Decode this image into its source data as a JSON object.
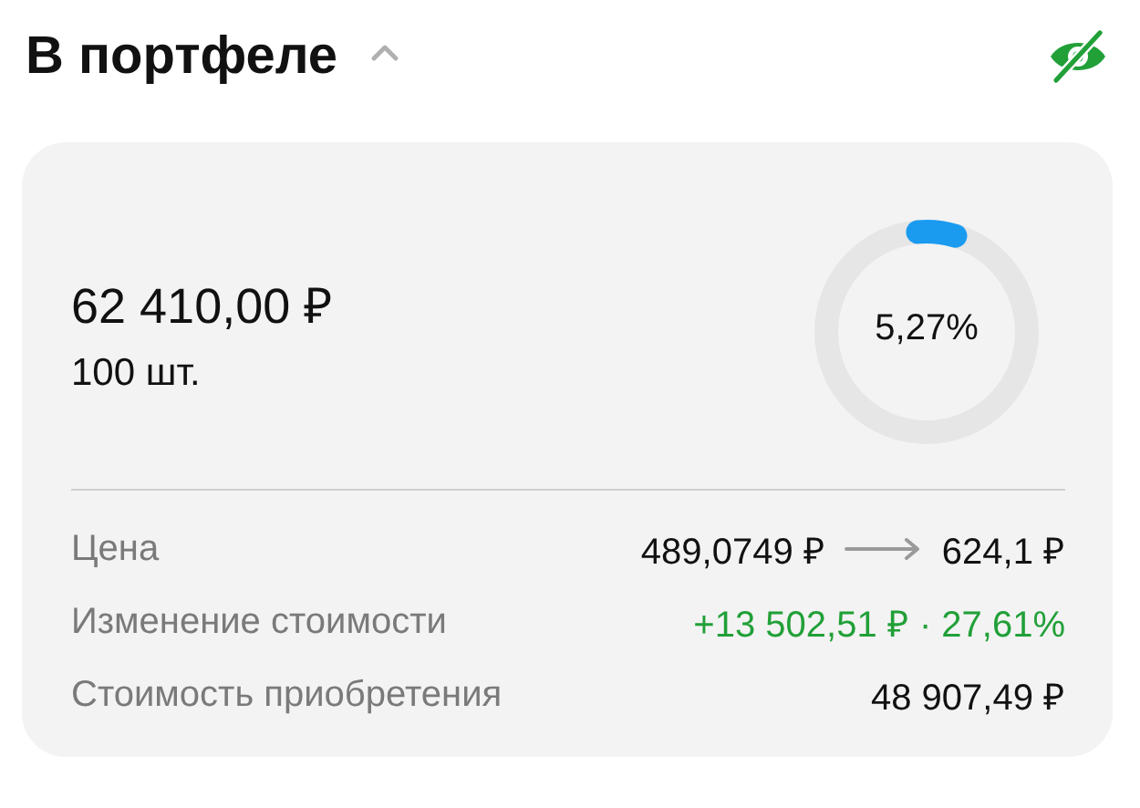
{
  "header": {
    "title": "В портфеле",
    "expanded": true
  },
  "card": {
    "amount": "62 410,00 ₽",
    "quantity": "100 шт.",
    "share": {
      "label": "5,27%"
    },
    "rows": [
      {
        "kind": "range",
        "label": "Цена",
        "from": "489,0749 ₽",
        "to": "624,1 ₽"
      },
      {
        "kind": "gain",
        "label": "Изменение стоимости",
        "value": "+13 502,51 ₽ · 27,61%"
      },
      {
        "kind": "plain",
        "label": "Стоимость приобретения",
        "value": "48 907,49 ₽"
      }
    ]
  }
}
